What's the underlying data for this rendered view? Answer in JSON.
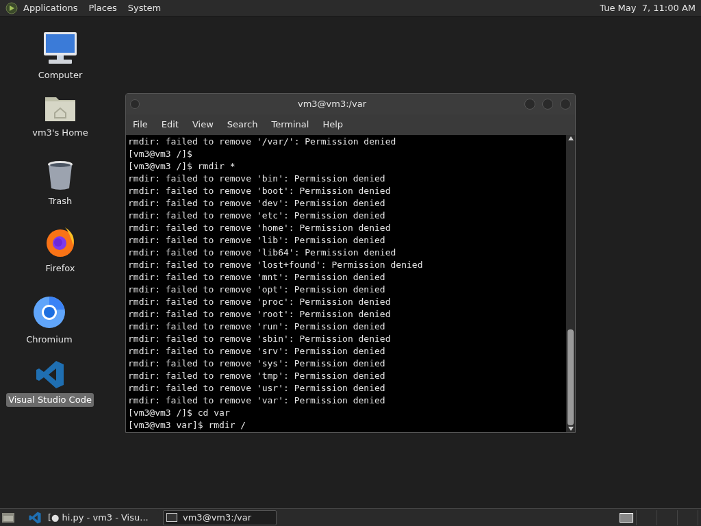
{
  "top_panel": {
    "menus": [
      "Applications",
      "Places",
      "System"
    ],
    "clock": "Tue May  7, 11:00 AM"
  },
  "desktop_icons": [
    {
      "kind": "computer",
      "label": "Computer",
      "selected": false
    },
    {
      "kind": "home",
      "label": "vm3's Home",
      "selected": false
    },
    {
      "kind": "trash",
      "label": "Trash",
      "selected": false
    },
    {
      "kind": "firefox",
      "label": "Firefox",
      "selected": false
    },
    {
      "kind": "chromium",
      "label": "Chromium",
      "selected": false
    },
    {
      "kind": "vscode",
      "label": "Visual Studio Code",
      "selected": true
    }
  ],
  "terminal": {
    "title": "vm3@vm3:/var",
    "menu": [
      "File",
      "Edit",
      "View",
      "Search",
      "Terminal",
      "Help"
    ],
    "lines": [
      "rmdir: failed to remove '/var/': Permission denied",
      "[vm3@vm3 /]$",
      "[vm3@vm3 /]$ rmdir *",
      "rmdir: failed to remove 'bin': Permission denied",
      "rmdir: failed to remove 'boot': Permission denied",
      "rmdir: failed to remove 'dev': Permission denied",
      "rmdir: failed to remove 'etc': Permission denied",
      "rmdir: failed to remove 'home': Permission denied",
      "rmdir: failed to remove 'lib': Permission denied",
      "rmdir: failed to remove 'lib64': Permission denied",
      "rmdir: failed to remove 'lost+found': Permission denied",
      "rmdir: failed to remove 'mnt': Permission denied",
      "rmdir: failed to remove 'opt': Permission denied",
      "rmdir: failed to remove 'proc': Permission denied",
      "rmdir: failed to remove 'root': Permission denied",
      "rmdir: failed to remove 'run': Permission denied",
      "rmdir: failed to remove 'sbin': Permission denied",
      "rmdir: failed to remove 'srv': Permission denied",
      "rmdir: failed to remove 'sys': Permission denied",
      "rmdir: failed to remove 'tmp': Permission denied",
      "rmdir: failed to remove 'usr': Permission denied",
      "rmdir: failed to remove 'var': Permission denied",
      "[vm3@vm3 /]$ cd var",
      "[vm3@vm3 var]$ rmdir /"
    ]
  },
  "taskbar": {
    "tasks": [
      {
        "kind": "editor",
        "label": "[● hi.py - vm3 - Visu...",
        "selected": false
      },
      {
        "kind": "terminal",
        "label": "vm3@vm3:/var",
        "selected": true
      }
    ],
    "workspaces": [
      {
        "selected": true
      },
      {
        "selected": false
      },
      {
        "selected": false
      },
      {
        "selected": false
      }
    ]
  }
}
